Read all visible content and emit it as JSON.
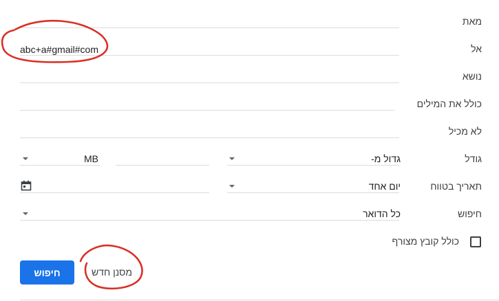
{
  "form": {
    "from_label": "מאת",
    "to_label": "אל",
    "to_value": "abc+a#gmail#com",
    "subject_label": "נושא",
    "has_words_label": "כולל את המילים",
    "not_has_label": "לא מכיל",
    "size_label": "גודל",
    "size_op": "גדול מ-",
    "size_unit": "MB",
    "date_label": "תאריך בטווח",
    "date_range": "יום אחד",
    "search_label": "חיפוש",
    "search_scope": "כל הדואר",
    "attachment_label": "כולל קובץ מצורף"
  },
  "buttons": {
    "search": "חיפוש",
    "create_filter": "מסנן חדש"
  },
  "colors": {
    "primary": "#1a73e8",
    "annotation": "#d93025"
  }
}
